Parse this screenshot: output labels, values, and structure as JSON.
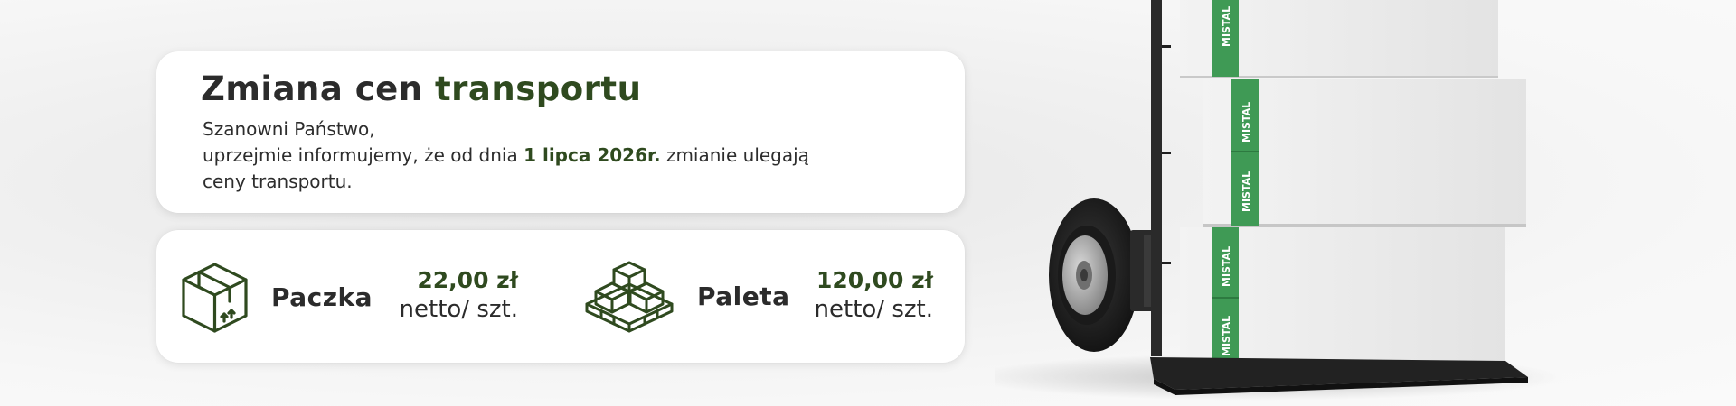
{
  "info": {
    "headline_part1": "Zmiana cen",
    "headline_part2": "transportu",
    "greeting": "Szanowni Państwo,",
    "message_before_date": "uprzejmie informujemy, że od dnia",
    "date": "1 lipca 2026r.",
    "message_after_date": "zmianie ulegają",
    "message_line3": "ceny transportu."
  },
  "prices": [
    {
      "icon": "parcel-box-icon",
      "label": "Paczka",
      "price": "22,00 zł",
      "unit": "netto/ szt."
    },
    {
      "icon": "pallet-boxes-icon",
      "label": "Paleta",
      "price": "120,00 zł",
      "unit": "netto/ szt."
    }
  ],
  "image": {
    "brand_text": "MISTAL"
  },
  "colors": {
    "accent": "#2f4a1f",
    "tape_green": "#3f9a55",
    "text": "#2b2b2b"
  }
}
